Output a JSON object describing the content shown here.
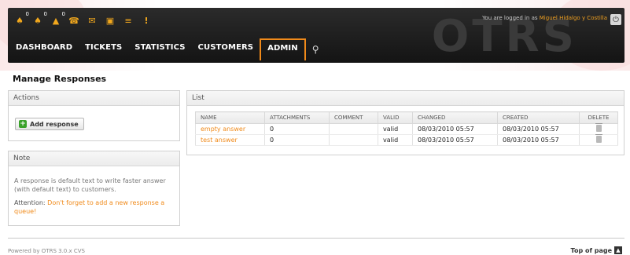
{
  "header": {
    "brand": "OTRS",
    "login_prefix": "You are logged in as",
    "user_name": "Miguel Hidalgo y Costilla",
    "toolbar": [
      {
        "icon": "locked-tickets-icon",
        "count": "0"
      },
      {
        "icon": "watched-tickets-icon",
        "count": "0"
      },
      {
        "icon": "responsible-tickets-icon",
        "count": "0"
      },
      {
        "icon": "phone-ticket-icon"
      },
      {
        "icon": "email-ticket-icon"
      },
      {
        "icon": "open-ticket-icon"
      },
      {
        "icon": "queue-view-icon"
      },
      {
        "icon": "escalation-warning-icon",
        "glyph": "!"
      }
    ],
    "nav": [
      "DASHBOARD",
      "TICKETS",
      "STATISTICS",
      "CUSTOMERS",
      "ADMIN"
    ],
    "active_nav": "ADMIN"
  },
  "page": {
    "title": "Manage Responses"
  },
  "sidebar": {
    "actions": {
      "title": "Actions",
      "add_label": "Add response"
    },
    "note": {
      "title": "Note",
      "text": "A response is default text to write faster answer (with default text) to customers.",
      "attention_label": "Attention:",
      "attention_link": "Don't forget to add a new response a queue!"
    }
  },
  "list": {
    "title": "List",
    "columns": [
      "NAME",
      "ATTACHMENTS",
      "COMMENT",
      "VALID",
      "CHANGED",
      "CREATED",
      "DELETE"
    ],
    "rows": [
      {
        "name": "empty answer",
        "attachments": "0",
        "comment": "",
        "valid": "valid",
        "changed": "08/03/2010 05:57",
        "created": "08/03/2010 05:57"
      },
      {
        "name": "test answer",
        "attachments": "0",
        "comment": "",
        "valid": "valid",
        "changed": "08/03/2010 05:57",
        "created": "08/03/2010 05:57"
      }
    ]
  },
  "footer": {
    "powered": "Powered by OTRS 3.0.x CVS",
    "top_of_page": "Top of page"
  },
  "colors": {
    "accent": "#f08a1a",
    "header_bg": "#1e1e1e",
    "add_icon": "#3aa12a"
  }
}
